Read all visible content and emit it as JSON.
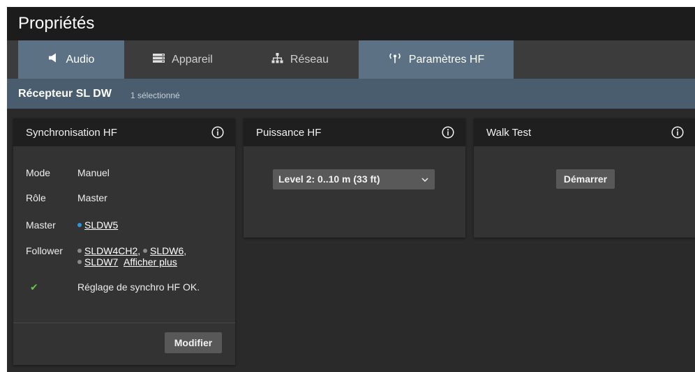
{
  "window": {
    "title": "Propriétés"
  },
  "tabs": [
    {
      "label": "Audio",
      "icon": "speaker-icon"
    },
    {
      "label": "Appareil",
      "icon": "device-icon"
    },
    {
      "label": "Réseau",
      "icon": "network-icon"
    },
    {
      "label": "Paramètres HF",
      "icon": "antenna-icon"
    }
  ],
  "device": {
    "name": "Récepteur SL DW",
    "selection": "1 sélectionné"
  },
  "sync_panel": {
    "title": "Synchronisation HF",
    "rows": {
      "mode": {
        "key": "Mode",
        "value": "Manuel"
      },
      "role": {
        "key": "Rôle",
        "value": "Master"
      },
      "master": {
        "key": "Master",
        "value": "SLDW5"
      },
      "follower": {
        "key": "Follower",
        "items": [
          "SLDW4CH2",
          "SLDW6",
          "SLDW7"
        ],
        "more": "Afficher plus"
      }
    },
    "status": "Réglage de synchro HF OK.",
    "modify_label": "Modifier"
  },
  "power_panel": {
    "title": "Puissance HF",
    "selected": "Level 2: 0..10 m (33 ft)"
  },
  "walk_panel": {
    "title": "Walk Test",
    "start_label": "Démarrer"
  },
  "colors": {
    "active_tab": "#5c7184",
    "device_bar": "#4a5d6e",
    "master_dot": "#2b95e0",
    "follower_dot": "#8a8a8a",
    "ok_check": "#6cc24a"
  }
}
